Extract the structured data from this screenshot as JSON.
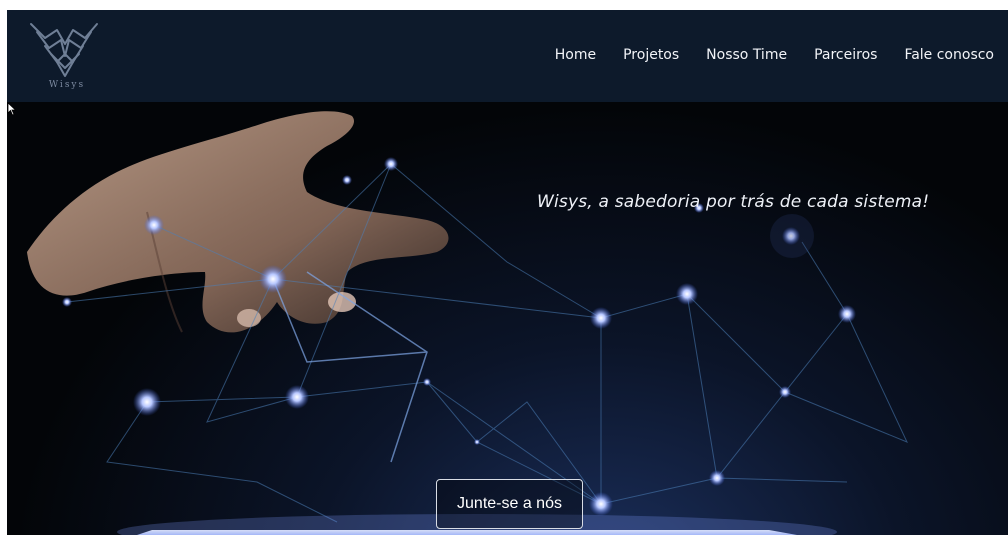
{
  "brand": {
    "name": "Wisys"
  },
  "nav": {
    "items": [
      {
        "label": "Home"
      },
      {
        "label": "Projetos"
      },
      {
        "label": "Nosso Time"
      },
      {
        "label": "Parceiros"
      },
      {
        "label": "Fale conosco"
      }
    ]
  },
  "hero": {
    "tagline": "Wisys, a sabedoria por trás de cada sistema!",
    "cta_label": "Junte-se a nós"
  },
  "colors": {
    "navbar_bg": "#0d1a2b",
    "nav_text": "#f2f4f8",
    "glow_node": "#9fb6ff"
  },
  "icons": {
    "logo": "wisys-bird-logo-icon",
    "cursor": "mouse-pointer-icon"
  }
}
